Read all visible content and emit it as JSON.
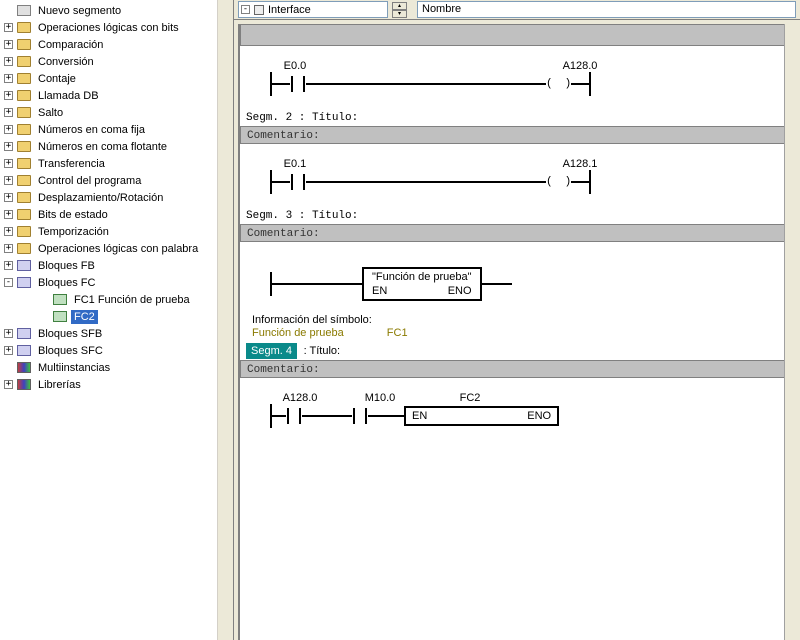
{
  "topbar": {
    "interface_label": "Interface",
    "nombre_label": "Nombre"
  },
  "tree": {
    "items": [
      {
        "exp": "",
        "icon": "seg",
        "label": "Nuevo segmento"
      },
      {
        "exp": "+",
        "icon": "folder",
        "label": "Operaciones lógicas con bits"
      },
      {
        "exp": "+",
        "icon": "folder",
        "label": "Comparación"
      },
      {
        "exp": "+",
        "icon": "folder",
        "label": "Conversión"
      },
      {
        "exp": "+",
        "icon": "folder",
        "label": "Contaje"
      },
      {
        "exp": "+",
        "icon": "folder",
        "label": "Llamada DB"
      },
      {
        "exp": "+",
        "icon": "folder",
        "label": "Salto"
      },
      {
        "exp": "+",
        "icon": "folder",
        "label": "Números en coma fija"
      },
      {
        "exp": "+",
        "icon": "folder",
        "label": "Números en coma flotante"
      },
      {
        "exp": "+",
        "icon": "folder",
        "label": "Transferencia"
      },
      {
        "exp": "+",
        "icon": "folder",
        "label": "Control del programa"
      },
      {
        "exp": "+",
        "icon": "folder",
        "label": "Desplazamiento/Rotación"
      },
      {
        "exp": "+",
        "icon": "folder",
        "label": "Bits de estado"
      },
      {
        "exp": "+",
        "icon": "folder",
        "label": "Temporización"
      },
      {
        "exp": "+",
        "icon": "folder",
        "label": "Operaciones lógicas con palabra"
      },
      {
        "exp": "+",
        "icon": "block",
        "label": "Bloques FB"
      },
      {
        "exp": "-",
        "icon": "block",
        "label": "Bloques FC"
      }
    ],
    "fc_children": [
      {
        "label": "FC1   Función de prueba"
      },
      {
        "label": "FC2",
        "selected": true
      }
    ],
    "items2": [
      {
        "exp": "+",
        "icon": "block",
        "label": "Bloques SFB"
      },
      {
        "exp": "+",
        "icon": "block",
        "label": "Bloques SFC"
      },
      {
        "exp": "",
        "icon": "lib",
        "label": "Multiinstancias"
      },
      {
        "exp": "+",
        "icon": "lib",
        "label": "Librerías"
      }
    ]
  },
  "editor": {
    "seg1": {
      "in": "E0.0",
      "out": "A128.0"
    },
    "seg2": {
      "title": "Segm. 2 : Título:",
      "comment": "Comentario:",
      "in": "E0.1",
      "out": "A128.1"
    },
    "seg3": {
      "title": "Segm. 3 : Título:",
      "comment": "Comentario:",
      "box_title": "\"Función de prueba\"",
      "en": "EN",
      "eno": "ENO"
    },
    "symbol": {
      "head": "Información del símbolo:",
      "name": "Función de prueba",
      "code": "FC1"
    },
    "seg4": {
      "titlePrefix": "Segm. 4",
      "titleSuffix": ": Título:",
      "comment": "Comentario:",
      "c1": "A128.0",
      "c2": "M10.0",
      "box": "FC2",
      "en": "EN",
      "eno": "ENO"
    }
  }
}
